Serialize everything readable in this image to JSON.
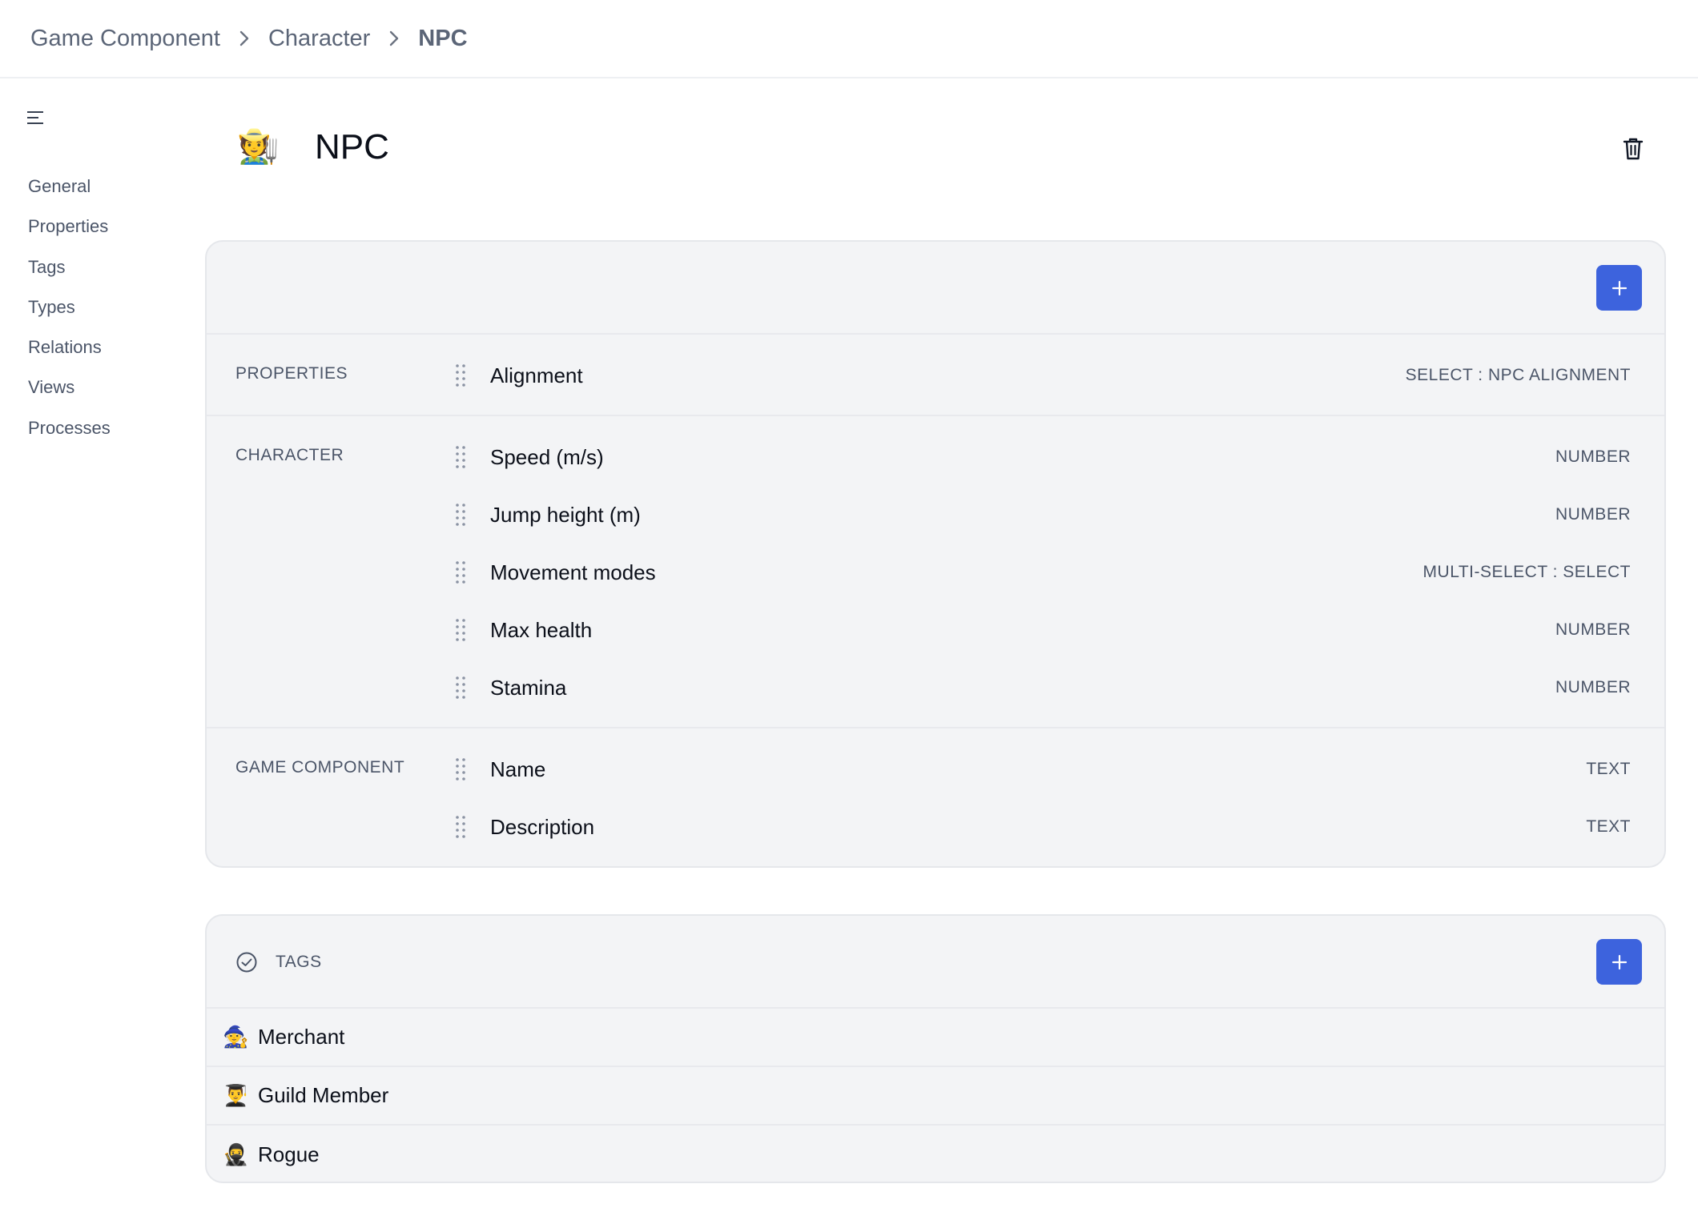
{
  "breadcrumb": {
    "items": [
      "Game Component",
      "Character",
      "NPC"
    ]
  },
  "sidebar": {
    "items": [
      "General",
      "Properties",
      "Tags",
      "Types",
      "Relations",
      "Views",
      "Processes"
    ]
  },
  "header": {
    "emoji": "🧑‍🌾",
    "title": "NPC"
  },
  "properties": {
    "groups": [
      {
        "label": "PROPERTIES",
        "rows": [
          {
            "name": "Alignment",
            "type": "SELECT : NPC ALIGNMENT"
          }
        ]
      },
      {
        "label": "CHARACTER",
        "rows": [
          {
            "name": "Speed (m/s)",
            "type": "NUMBER"
          },
          {
            "name": "Jump height (m)",
            "type": "NUMBER"
          },
          {
            "name": "Movement modes",
            "type": "MULTI-SELECT : SELECT"
          },
          {
            "name": "Max health",
            "type": "NUMBER"
          },
          {
            "name": "Stamina",
            "type": "NUMBER"
          }
        ]
      },
      {
        "label": "GAME COMPONENT",
        "rows": [
          {
            "name": "Name",
            "type": "TEXT"
          },
          {
            "name": "Description",
            "type": "TEXT"
          }
        ]
      }
    ]
  },
  "tags": {
    "label": "TAGS",
    "items": [
      {
        "emoji": "🧙",
        "name": "Merchant"
      },
      {
        "emoji": "👨‍🎓",
        "name": "Guild Member"
      },
      {
        "emoji": "🥷",
        "name": "Rogue"
      }
    ]
  },
  "colors": {
    "accent": "#3d63dd",
    "panel_bg": "#f3f4f6",
    "muted_text": "#4b5568"
  }
}
